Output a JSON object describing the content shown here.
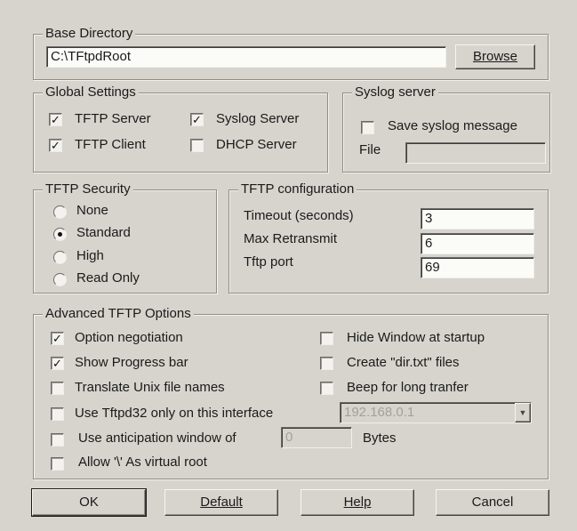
{
  "base_directory": {
    "legend": "Base Directory",
    "path_value": "C:\\TFtpdRoot",
    "browse_label": "Browse"
  },
  "global_settings": {
    "legend": "Global Settings",
    "tftp_server": {
      "label": "TFTP Server",
      "checked": true
    },
    "syslog_server": {
      "label": "Syslog Server",
      "checked": true
    },
    "tftp_client": {
      "label": "TFTP Client",
      "checked": true
    },
    "dhcp_server": {
      "label": "DHCP Server",
      "checked": false
    }
  },
  "syslog": {
    "legend": "Syslog server",
    "save_label": "Save syslog message",
    "save_checked": false,
    "file_label": "File",
    "file_value": ""
  },
  "security": {
    "legend": "TFTP Security",
    "options": [
      "None",
      "Standard",
      "High",
      "Read Only"
    ],
    "selected": "Standard"
  },
  "config": {
    "legend": "TFTP configuration",
    "timeout_label": "Timeout (seconds)",
    "timeout_value": "3",
    "retransmit_label": "Max Retransmit",
    "retransmit_value": "6",
    "port_label": "Tftp port",
    "port_value": "69"
  },
  "advanced": {
    "legend": "Advanced TFTP Options",
    "option_negotiation": {
      "label": "Option negotiation",
      "checked": true
    },
    "show_progress": {
      "label": "Show Progress bar",
      "checked": true
    },
    "translate_unix": {
      "label": "Translate Unix file names",
      "checked": false
    },
    "use_interface": {
      "label": "Use Tftpd32 only on this interface",
      "checked": false
    },
    "interface_value": "192.168.0.1",
    "anticipation": {
      "label": "Use anticipation window of",
      "checked": false
    },
    "anticipation_value": "0",
    "bytes_label": "Bytes",
    "virtual_root": {
      "label": "Allow '\\' As virtual root",
      "checked": false
    },
    "hide_window": {
      "label": "Hide Window at startup",
      "checked": false
    },
    "create_dir": {
      "label": "Create \"dir.txt\" files",
      "checked": false
    },
    "beep": {
      "label": "Beep for long tranfer",
      "checked": false
    }
  },
  "buttons": {
    "ok": "OK",
    "default": "Default",
    "help": "Help",
    "cancel": "Cancel"
  },
  "check_glyph": "✓"
}
